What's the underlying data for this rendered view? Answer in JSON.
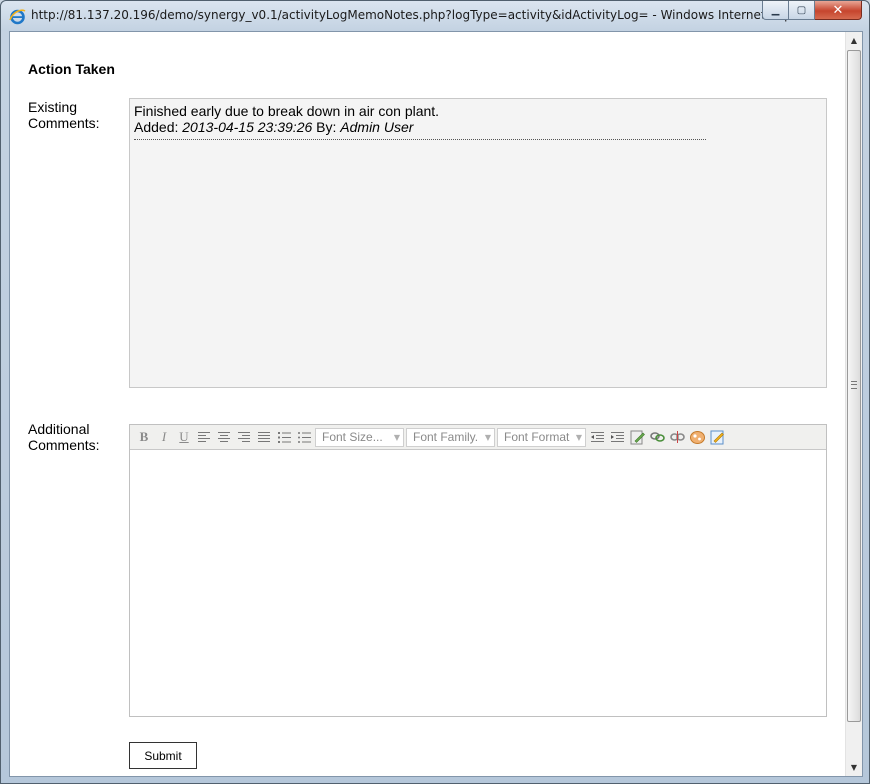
{
  "window": {
    "title": "http://81.137.20.196/demo/synergy_v0.1/activityLogMemoNotes.php?logType=activity&idActivityLog= - Windows Internet Explorer",
    "minimize_glyph": "▁",
    "maximize_glyph": "▢",
    "close_glyph": "✕"
  },
  "scrollbar": {
    "up_glyph": "▲",
    "down_glyph": "▼"
  },
  "page": {
    "heading": "Action Taken",
    "existing_label_line1": "Existing",
    "existing_label_line2": "Comments:",
    "additional_label_line1": "Additional",
    "additional_label_line2": "Comments:",
    "submit_label": "Submit"
  },
  "existing_comments": [
    {
      "text": "Finished early due to break down in air con plant.",
      "added_prefix": "Added:",
      "timestamp": "2013-04-15 23:39:26",
      "by_prefix": "By:",
      "author": "Admin User"
    }
  ],
  "toolbar": {
    "bold": "B",
    "italic": "I",
    "underline": "U",
    "font_size": "Font Size...",
    "font_family": "Font Family.",
    "font_format": "Font Format",
    "dropdown_glyph": "▼"
  }
}
